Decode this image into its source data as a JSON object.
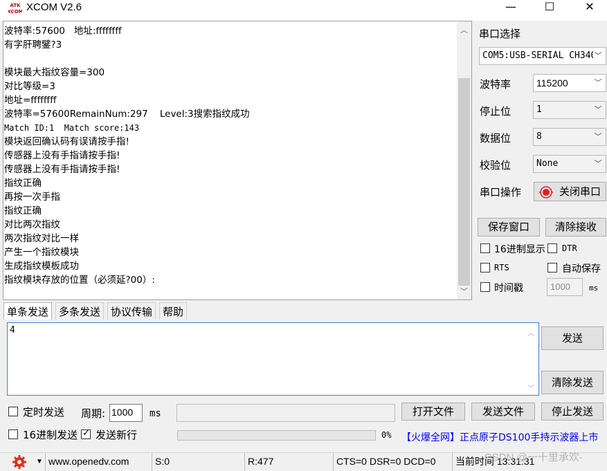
{
  "window": {
    "title": "XCOM V2.6",
    "controls": {
      "minimize": "—",
      "maximize": "☐",
      "close": "✕"
    }
  },
  "receive": {
    "lines": [
      "波特率:57600   地址:ffffffff",
      "有字肝聘鐾?3",
      "",
      "模块最大指纹容量=300",
      "对比等级=3",
      "地址=ffffffff",
      "波特率=57600RemainNum:297    Level:3搜索指纹成功",
      "Match ID:1  Match score:143",
      "模块返回确认码有误请按手指!",
      "传感器上没有手指请按手指!",
      "传感器上没有手指请按手指!",
      "指纹正确",
      "再按一次手指",
      "指纹正确",
      "对比两次指纹",
      "两次指纹对比一样",
      "产生一个指纹模块",
      "生成指纹模板成功",
      "指纹模块存放的位置（必须延?00）:"
    ]
  },
  "serial": {
    "port_select_label": "串口选择",
    "port_value": "COM5:USB-SERIAL CH340",
    "baud_label": "波特率",
    "baud_value": "115200",
    "stopbits_label": "停止位",
    "stopbits_value": "1",
    "databits_label": "数据位",
    "databits_value": "8",
    "parity_label": "校验位",
    "parity_value": "None",
    "operation_label": "串口操作",
    "close_port_button": "关闭串口",
    "status_color": "#e02020"
  },
  "receive_options": {
    "save_window_button": "保存窗口",
    "clear_receive_button": "清除接收",
    "hex_display_label": "16进制显示",
    "hex_display_checked": false,
    "dtr_label": "DTR",
    "dtr_checked": false,
    "rts_label": "RTS",
    "rts_checked": false,
    "auto_save_label": "自动保存",
    "auto_save_checked": false,
    "timestamp_label": "时间戳",
    "timestamp_checked": false,
    "timestamp_interval": "1000",
    "timestamp_unit": "ms"
  },
  "tabs": [
    {
      "label": "单条发送",
      "active": true
    },
    {
      "label": "多条发送",
      "active": false
    },
    {
      "label": "协议传输",
      "active": false
    },
    {
      "label": "帮助",
      "active": false
    }
  ],
  "send": {
    "text": "4",
    "send_button": "发送",
    "clear_send_button": "清除发送",
    "timed_send_label": "定时发送",
    "timed_send_checked": false,
    "period_label": "周期:",
    "period_value": "1000",
    "period_unit": "ms",
    "file_path": "",
    "open_file_button": "打开文件",
    "send_file_button": "发送文件",
    "stop_send_button": "停止发送",
    "hex_send_label": "16进制发送",
    "hex_send_checked": false,
    "send_newline_label": "发送新行",
    "send_newline_checked": true,
    "progress_percent": 0,
    "progress_text": "0%",
    "ad_link": "【火爆全网】正点原子DS100手持示波器上市"
  },
  "status": {
    "website": "www.openedv.com",
    "sent": "S:0",
    "received": "R:477",
    "lines": "CTS=0 DSR=0 DCD=0",
    "time": "当前时间 13:31:31"
  },
  "watermark": "CSDN @一十里承欢-"
}
